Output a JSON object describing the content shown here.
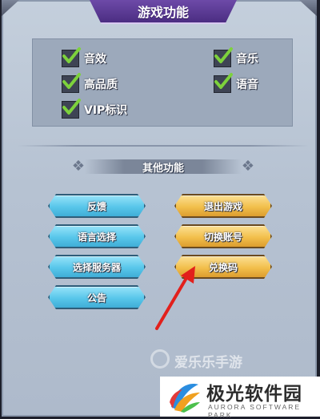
{
  "window": {
    "title": "游戏功能"
  },
  "settings": [
    {
      "label": "音效",
      "checked": true
    },
    {
      "label": "音乐",
      "checked": true
    },
    {
      "label": "高品质",
      "checked": true
    },
    {
      "label": "语音",
      "checked": true
    },
    {
      "label": "VIP标识",
      "checked": true
    }
  ],
  "other_section": {
    "title": "其他功能"
  },
  "buttons": {
    "feedback": "反馈",
    "language": "语言选择",
    "server": "选择服务器",
    "notice": "公告",
    "exit_game": "退出游戏",
    "switch_account": "切换账号",
    "redeem_code": "兑换码"
  },
  "watermark": "爱乐乐手游",
  "brand": {
    "name": "极光软件园",
    "sub": "AURORA SOFTWARE PARK"
  },
  "colors": {
    "blue_button": "#58c6ea",
    "gold_button": "#f2bf4b",
    "annotation_arrow": "#e2201c",
    "check": "#7dd23c"
  }
}
